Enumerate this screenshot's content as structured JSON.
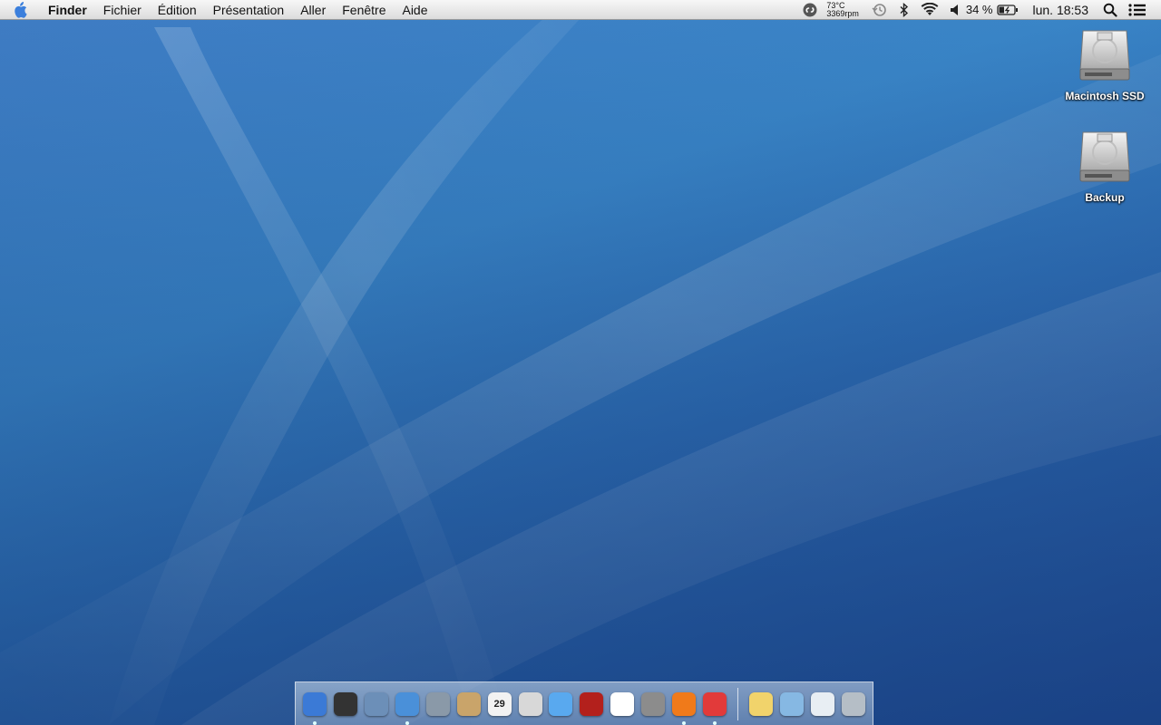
{
  "menubar": {
    "app_name": "Finder",
    "menus": [
      "Fichier",
      "Édition",
      "Présentation",
      "Aller",
      "Fenêtre",
      "Aide"
    ],
    "status": {
      "temperature": "73°C",
      "fan_speed": "3369rpm",
      "battery": "34 %",
      "clock": "lun. 18:53"
    }
  },
  "desktop": {
    "icons": [
      {
        "label": "Macintosh SSD",
        "icon": "hard-drive-icon"
      },
      {
        "label": "Backup",
        "icon": "hard-drive-icon"
      }
    ]
  },
  "dock": {
    "apps": [
      {
        "name": "finder",
        "icon": "finder-icon",
        "running": true,
        "color": "#3b7ad6"
      },
      {
        "name": "launchpad",
        "icon": "dashboard-icon",
        "running": false,
        "color": "#333333"
      },
      {
        "name": "preview",
        "icon": "preview-icon",
        "running": false,
        "color": "#6c8fb8"
      },
      {
        "name": "safari",
        "icon": "safari-icon",
        "running": true,
        "color": "#4a90d9"
      },
      {
        "name": "facetime",
        "icon": "facetime-icon",
        "running": false,
        "color": "#8a99a8"
      },
      {
        "name": "contacts",
        "icon": "address-book-icon",
        "running": false,
        "color": "#c9a46a"
      },
      {
        "name": "calendar",
        "icon": "calendar-icon",
        "running": false,
        "color": "#f2f2f2",
        "text": "29"
      },
      {
        "name": "photo-booth",
        "icon": "photos-icon",
        "running": false,
        "color": "#d8d8d8"
      },
      {
        "name": "messages",
        "icon": "messages-icon",
        "running": false,
        "color": "#59a9ef"
      },
      {
        "name": "photo-booth-2",
        "icon": "photo-booth-icon",
        "running": false,
        "color": "#b3201c"
      },
      {
        "name": "itunes",
        "icon": "itunes-icon",
        "running": false,
        "color": "#ffffff"
      },
      {
        "name": "system-preferences",
        "icon": "system-preferences-icon",
        "running": false,
        "color": "#8c8c8c"
      },
      {
        "name": "vlc-like-app",
        "icon": "orange-ring-app-icon",
        "running": true,
        "color": "#f07a1a"
      },
      {
        "name": "red-app",
        "icon": "red-app-icon",
        "running": true,
        "color": "#e23a3a"
      }
    ],
    "stacks": [
      {
        "name": "notes",
        "icon": "stickies-icon",
        "color": "#f1d36b"
      },
      {
        "name": "documents-folder",
        "icon": "folder-icon",
        "color": "#86b8e3"
      },
      {
        "name": "downloads",
        "icon": "downloads-icon",
        "color": "#e8eef3"
      },
      {
        "name": "trash",
        "icon": "trash-icon",
        "color": "#b5bec6"
      }
    ]
  }
}
